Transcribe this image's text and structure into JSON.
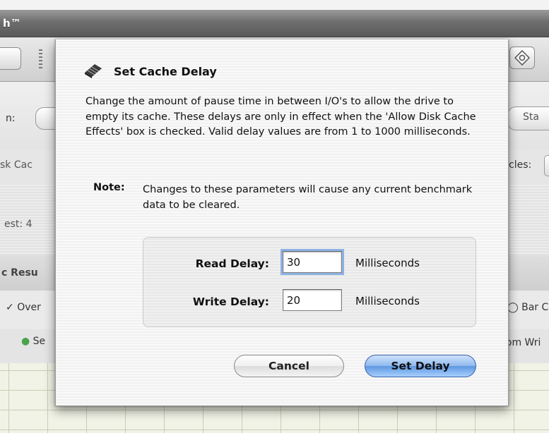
{
  "background": {
    "app_title": "h™",
    "labels": {
      "row1_left": "n:",
      "row1_right": "Sta",
      "row2_left": "sk Cac",
      "row2_right": "cles:",
      "row3_left": "est: 4",
      "row4_left": "c Resu",
      "row5_left": "Over",
      "row5_right": "Bar C",
      "row6_left": "Se",
      "row6_right": "lom Wri"
    }
  },
  "dialog": {
    "title": "Set Cache Delay",
    "icon": "memory-chip-icon",
    "description": "Change the amount of pause time in between I/O's to allow the drive to empty its cache.  These delays are only in effect when the 'Allow Disk Cache Effects' box is checked.  Valid delay values are from 1 to 1000 milliseconds.",
    "note_label": "Note:",
    "note_text": "Changes to these parameters will cause any current benchmark data to be cleared.",
    "fields": {
      "read": {
        "label": "Read Delay:",
        "value": "30",
        "unit": "Milliseconds"
      },
      "write": {
        "label": "Write Delay:",
        "value": "20",
        "unit": "Milliseconds"
      }
    },
    "buttons": {
      "cancel": "Cancel",
      "confirm": "Set Delay"
    }
  },
  "colors": {
    "default_button": "#6ea3e6",
    "focus_ring": "#8db2e3",
    "sheet": "#f5f5f5"
  }
}
